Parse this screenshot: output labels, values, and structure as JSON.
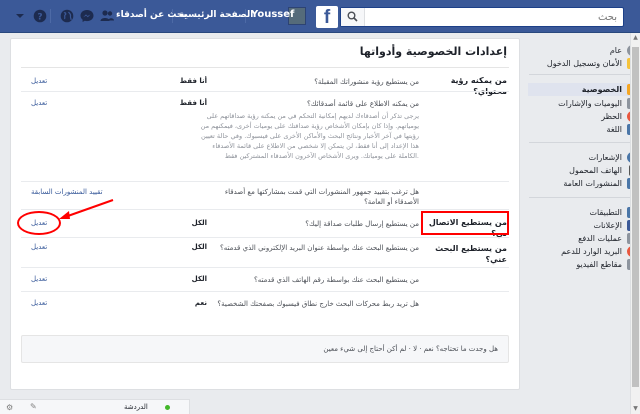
{
  "topbar": {
    "search_placeholder": "بحث",
    "profile_name": "Youssef",
    "home_label": "الصفحة الرئيسية",
    "find_friends_label": "بحث عن أصدقاء"
  },
  "sidebar": {
    "items": [
      {
        "label": "عام",
        "icon": "gear-icon",
        "color": "#7f7f7f"
      },
      {
        "label": "الأمان وتسجيل الدخول",
        "icon": "shield-icon",
        "color": "#f5c33b"
      },
      {
        "label": "الخصوصية",
        "icon": "lock-icon",
        "color": "#f5a623"
      },
      {
        "label": "اليوميات والإشارات",
        "icon": "timeline-icon",
        "color": "#7f7f7f"
      },
      {
        "label": "الحظر",
        "icon": "block-icon",
        "color": "#e9573f"
      },
      {
        "label": "اللغة",
        "icon": "language-icon",
        "color": "#4a76a8"
      },
      {
        "label": "الإشعارات",
        "icon": "globe-icon",
        "color": "#4a76a8"
      },
      {
        "label": "الهاتف المحمول",
        "icon": "mobile-icon",
        "color": "#555555"
      },
      {
        "label": "المنشورات العامة",
        "icon": "rss-icon",
        "color": "#4a76a8"
      },
      {
        "label": "التطبيقات",
        "icon": "apps-icon",
        "color": "#4a76a8"
      },
      {
        "label": "الإعلانات",
        "icon": "ads-icon",
        "color": "#3b5998"
      },
      {
        "label": "عمليات الدفع",
        "icon": "payments-icon",
        "color": "#7f7f7f"
      },
      {
        "label": "البريد الوارد للدعم",
        "icon": "support-icon",
        "color": "#e9573f"
      },
      {
        "label": "مقاطع الفيديو",
        "icon": "video-icon",
        "color": "#7f7f7f"
      }
    ]
  },
  "panel": {
    "title": "إعدادات الخصوصية وأدواتها",
    "sections": [
      {
        "label": "من يمكنه رؤية محتواي؟",
        "rows": [
          {
            "question": "من يستطيع رؤية منشوراتك المقبلة؟",
            "value": "أنا فقط",
            "edit": "تعديل"
          },
          {
            "question": "من يمكنه الاطلاع على قائمة أصدقائك؟",
            "value": "أنا فقط",
            "edit": "تعديل",
            "description": "يرجى تذكر أن أصدقاءك لديهم إمكانية التحكم في من يمكنه رؤية صداقاتهم على يومياتهم. وإذا كان بإمكان الأشخاص رؤية صداقتك على يوميات أخرى، فيمكنهم من رؤيتها في آخر الأخبار ونتائج البحث والأماكن الأخرى على فيسبوك. وفي حالة تعيين هذا الإعداد إلى أنا فقط، لن يتمكن إلا شخصي من الاطلاع على قائمة الأصدقاء الكاملة على يومياتك. ويرى الأشخاص الآخرون الأصدقاء المشتركين فقط."
          },
          {
            "question": "هل ترغب بتقييد جمهور المنشورات التي قمت بمشاركتها مع أصدقاء الأصدقاء أو العامة؟",
            "value": "",
            "edit": "تقييد المنشورات السابقة"
          }
        ]
      },
      {
        "label": "من يستطيع الاتصال بي؟",
        "rows": [
          {
            "question": "من يستطيع إرسال طلبات صداقة إليك؟",
            "value": "الكل",
            "edit": "تعديل"
          }
        ]
      },
      {
        "label": "من يستطيع البحث عني؟",
        "rows": [
          {
            "question": "من يستطيع البحث عنك بواسطة عنوان البريد الإلكتروني الذي قدمته؟",
            "value": "الكل",
            "edit": "تعديل"
          },
          {
            "question": "من يستطيع البحث عنك بواسطة رقم الهاتف الذي قدمته؟",
            "value": "الكل",
            "edit": "تعديل"
          },
          {
            "question": "هل تريد ربط محركات البحث خارج نطاق فيسبوك بصفحتك الشخصية؟",
            "value": "نعم",
            "edit": "تعديل"
          }
        ]
      }
    ],
    "footer": "هل وجدت ما تحتاجه؟ نعم · لا · لم أكن أحتاج إلى شيء معين"
  },
  "chat": {
    "label": "الدردشة"
  },
  "colors": {
    "brand": "#3b5998",
    "highlight": "#ff0000",
    "link": "#365899"
  }
}
